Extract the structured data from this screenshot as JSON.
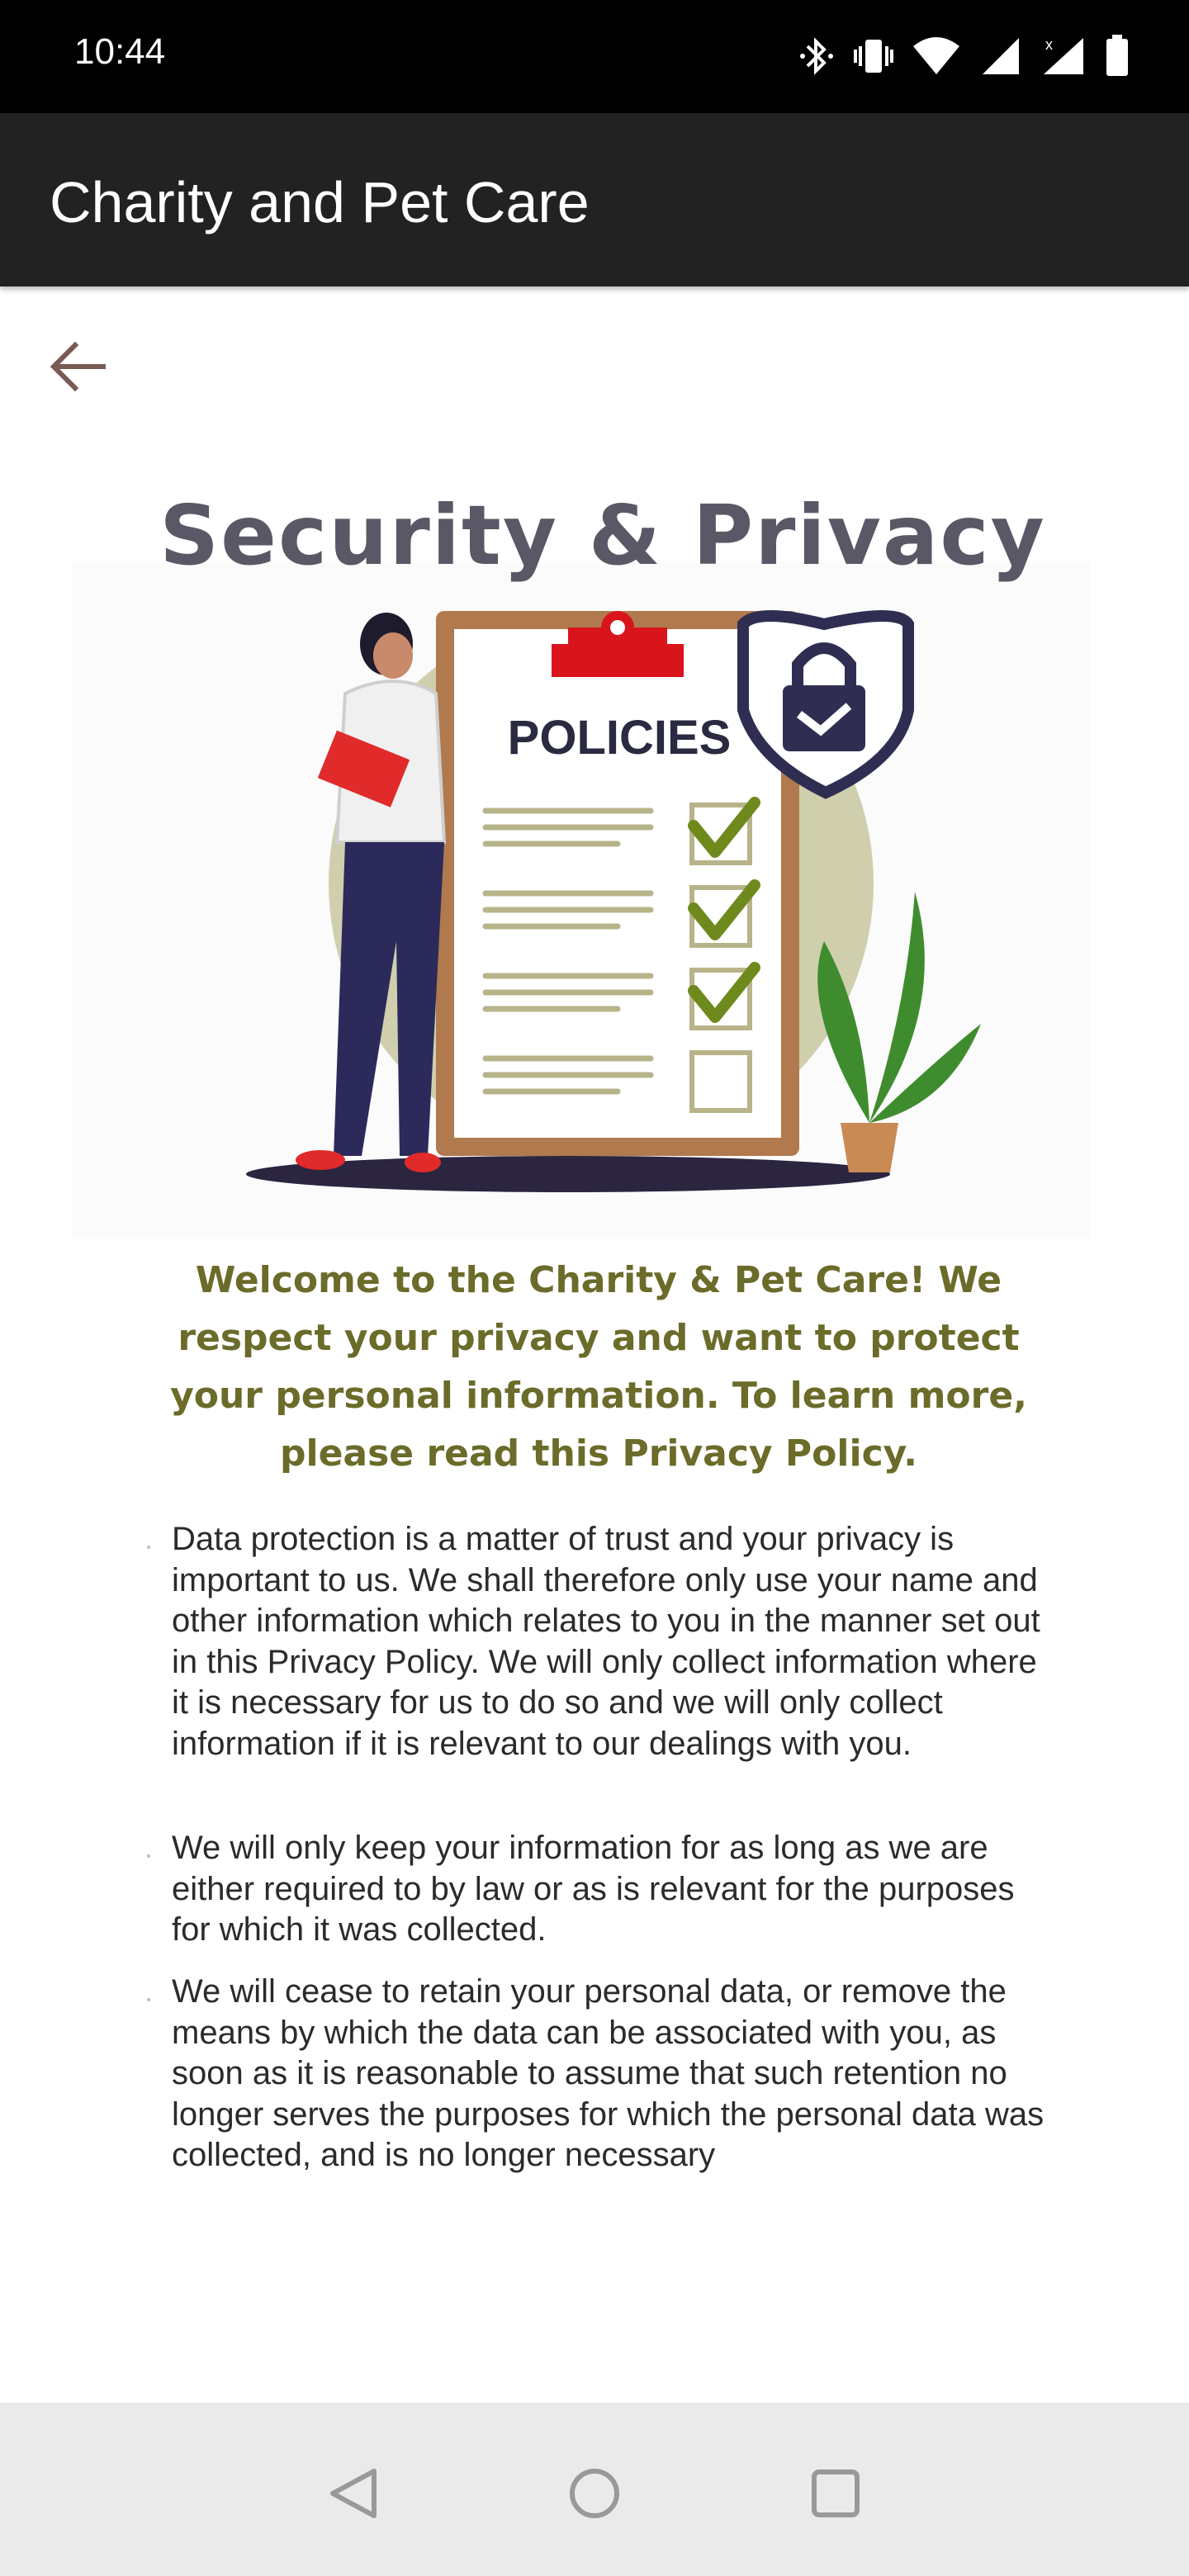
{
  "status_bar": {
    "time": "10:44",
    "icons": [
      "bluetooth-icon",
      "vibrate-icon",
      "wifi-icon",
      "signal-icon",
      "signal-no-data-icon",
      "battery-icon"
    ]
  },
  "app_bar": {
    "title": "Charity and Pet Care"
  },
  "back_button": {
    "icon": "arrow-back-icon"
  },
  "illustration": {
    "title": "Security & Privacy",
    "clipboard_label": "POLICIES",
    "colors": {
      "title": "#5a5866",
      "circle": "#cfcfae",
      "board": "#b07a4e",
      "check": "#6e8a1d",
      "shield": "#2f2e52",
      "clip": "#d9151b"
    }
  },
  "content": {
    "heading": "Welcome to the Charity & Pet Care! We respect your privacy and want to protect your personal information. To learn more, please read this Privacy Policy.",
    "paragraphs": [
      "Data protection is a matter of trust and your privacy is important to us. We shall therefore only use your name and other information which relates to you in the manner set out in this Privacy Policy. We will only collect information where it is necessary for us to do so and we will only collect information if it is relevant to our dealings with you.",
      "We will only keep your information for as long as we are either required to by law or as is relevant for the purposes for which it was collected.",
      "We will cease to retain your personal data, or remove the means by which the data can be associated with you, as soon as it is reasonable to assume that such retention no longer serves the purposes for which the personal data was collected, and is no longer necessary"
    ]
  },
  "nav_bar": {
    "buttons": [
      "nav-back-icon",
      "nav-home-icon",
      "nav-recents-icon"
    ]
  }
}
